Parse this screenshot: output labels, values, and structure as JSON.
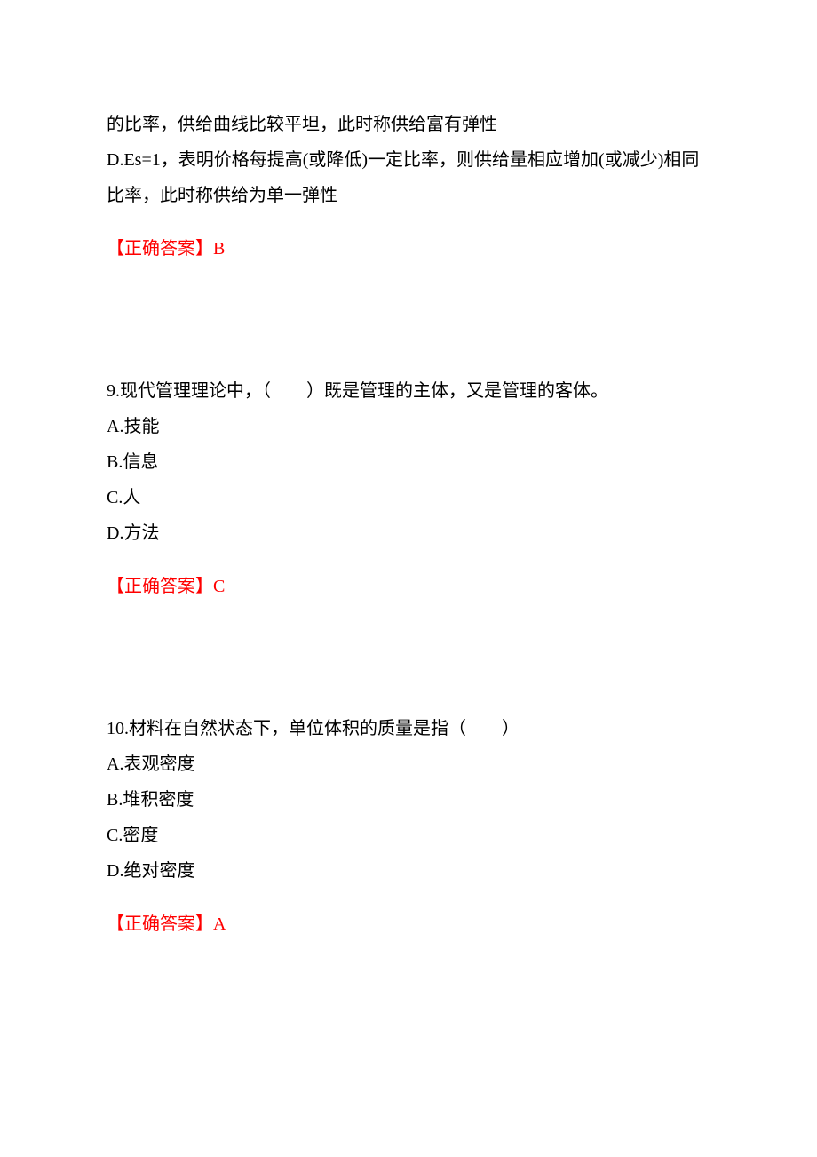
{
  "q8_fragment": {
    "lineC": "的比率，供给曲线比较平坦，此时称供给富有弹性",
    "lineD": "D.Es=1，表明价格每提高(或降低)一定比率，则供给量相应增加(或减少)相同比率，此时称供给为单一弹性",
    "answer_label": "【正确答案】",
    "answer_value": "B"
  },
  "q9": {
    "stem": "9.现代管理理论中，（　　）既是管理的主体，又是管理的客体。",
    "optA": "A.技能",
    "optB": "B.信息",
    "optC": "C.人",
    "optD": "D.方法",
    "answer_label": "【正确答案】",
    "answer_value": "C"
  },
  "q10": {
    "stem": "10.材料在自然状态下，单位体积的质量是指（　　）",
    "optA": "A.表观密度",
    "optB": "B.堆积密度",
    "optC": "C.密度",
    "optD": "D.绝对密度",
    "answer_label": "【正确答案】",
    "answer_value": "A"
  }
}
